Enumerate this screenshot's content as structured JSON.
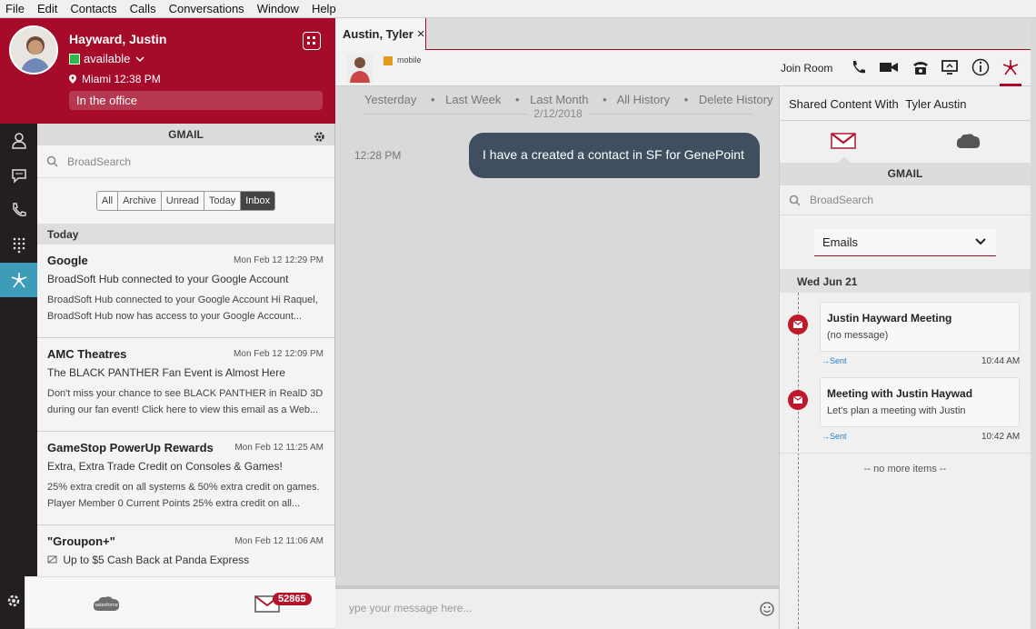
{
  "menu": [
    "File",
    "Edit",
    "Contacts",
    "Calls",
    "Conversations",
    "Window",
    "Help"
  ],
  "profile": {
    "name": "Hayward, Justin",
    "status": "available",
    "location": "Miami  12:38 PM",
    "note": "In the office"
  },
  "gmail_panel": {
    "header": "GMAIL",
    "search_placeholder": "BroadSearch",
    "filters": [
      "All",
      "Archive",
      "Unread",
      "Today",
      "Inbox"
    ],
    "section": "Today",
    "emails": [
      {
        "from": "Google",
        "date": "Mon Feb 12 12:29 PM",
        "subject": "BroadSoft Hub connected to your Google Account",
        "preview1": "BroadSoft Hub connected to your Google Account Hi Raquel,",
        "preview2": "BroadSoft Hub now has access to your Google Account..."
      },
      {
        "from": "AMC Theatres",
        "date": "Mon Feb 12 12:09 PM",
        "subject": "The BLACK PANTHER Fan Event is Almost Here",
        "preview1": "Don't miss your chance to see BLACK PANTHER in RealD 3D",
        "preview2": "during our fan event! Click here to view this email as a Web..."
      },
      {
        "from": "GameStop PowerUp Rewards",
        "date": "Mon Feb 12 11:25 AM",
        "subject": "Extra, Extra Trade Credit on Consoles & Games!",
        "preview1": "25% extra credit on all systems & 50% extra credit on games.",
        "preview2": "Player Member 0 Current Points 25% extra credit on all..."
      },
      {
        "from": "\"Groupon+\"",
        "date": "Mon Feb 12 11:06 AM",
        "subject": "Up to $5 Cash Back at Panda Express",
        "preview1": "",
        "preview2": ""
      }
    ]
  },
  "popup": {
    "salesforce_label": "salesforce",
    "unread_count": "52865"
  },
  "conversation": {
    "tab_title": "Austin, Tyler",
    "tab_close": "×",
    "device": "mobile",
    "join_room": "Join Room",
    "history_links": [
      "Yesterday",
      "Last Week",
      "Last Month",
      "All History",
      "Delete History"
    ],
    "history_sep": "•",
    "date_divider": "2/12/2018",
    "message_time": "12:28 PM",
    "message_text": "I have a created a contact in SF for GenePoint",
    "composer_placeholder": "ype your message here..."
  },
  "shared": {
    "title_prefix": "Shared Content With",
    "contact": "Tyler Austin",
    "gmail_header": "GMAIL",
    "search_placeholder": "BroadSearch",
    "select_value": "Emails",
    "date": "Wed Jun 21",
    "items": [
      {
        "title": "Justin Hayward Meeting",
        "desc": "(no message)",
        "direction": "→Sent",
        "time": "10:44 AM"
      },
      {
        "title": "Meeting with Justin Haywad",
        "desc": "Let's plan a meeting with Justin",
        "direction": "→Sent",
        "time": "10:42 AM"
      }
    ],
    "no_more": "-- no more items --"
  },
  "colors": {
    "brand": "#a70b2a",
    "bubble": "#3f4f5f",
    "rail": "#231f20",
    "rail_active": "#3d9cb7",
    "status_available": "#2db84b"
  }
}
